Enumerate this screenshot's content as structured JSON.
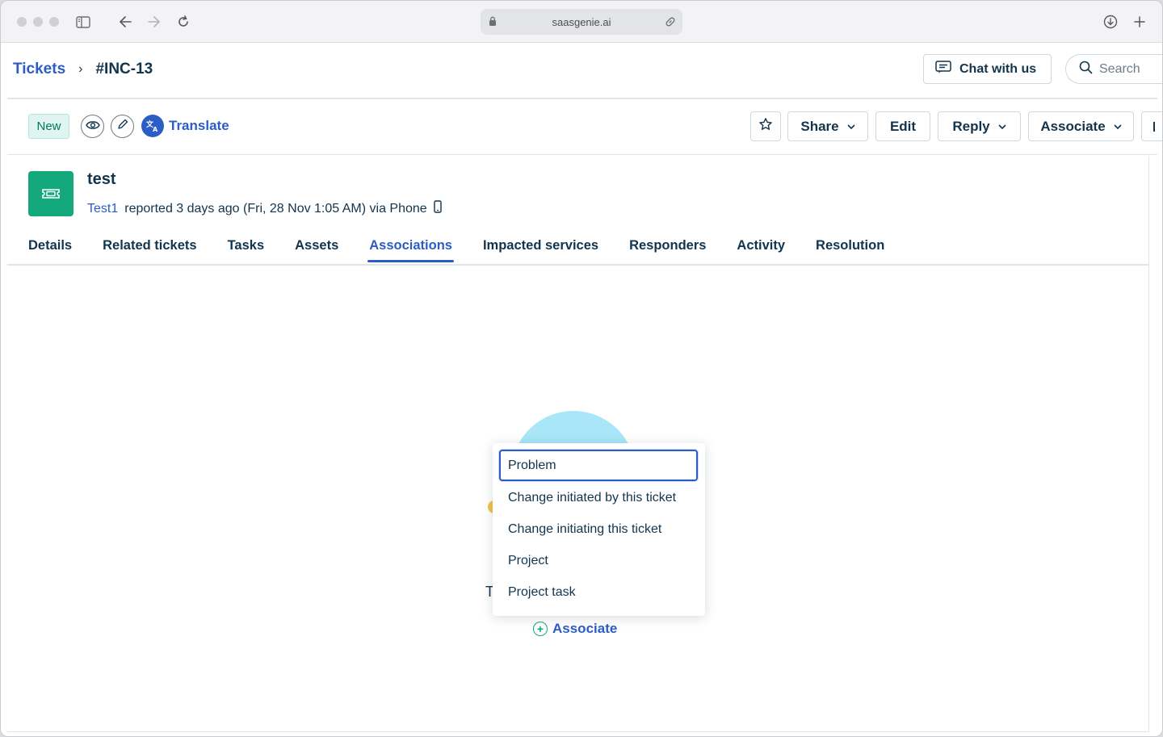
{
  "browser": {
    "url": "saasgenie.ai"
  },
  "header": {
    "breadcrumb_root": "Tickets",
    "breadcrumb_sep": "›",
    "breadcrumb_current": "#INC-13",
    "chat_label": "Chat with us",
    "search_placeholder": "Search"
  },
  "toolbar": {
    "status": "New",
    "translate_label": "Translate",
    "share_label": "Share",
    "edit_label": "Edit",
    "reply_label": "Reply",
    "associate_label": "Associate"
  },
  "ticket": {
    "title": "test",
    "requester": "Test1",
    "meta": "reported 3 days ago (Fri, 28 Nov 1:05 AM) via Phone"
  },
  "tabs": [
    {
      "label": "Details"
    },
    {
      "label": "Related tickets"
    },
    {
      "label": "Tasks"
    },
    {
      "label": "Assets"
    },
    {
      "label": "Associations"
    },
    {
      "label": "Impacted services"
    },
    {
      "label": "Responders"
    },
    {
      "label": "Activity"
    },
    {
      "label": "Resolution"
    }
  ],
  "active_tab": "Associations",
  "content": {
    "empty_text": "T",
    "associate_link": "Associate"
  },
  "dropdown": {
    "items": [
      {
        "label": "Problem"
      },
      {
        "label": "Change initiated by this ticket"
      },
      {
        "label": "Change initiating this ticket"
      },
      {
        "label": "Project"
      },
      {
        "label": "Project task"
      }
    ]
  },
  "colors": {
    "accent": "#2c5cc5",
    "status_new_bg": "#e0f5f1",
    "ticket_icon_bg": "#13a97c"
  }
}
